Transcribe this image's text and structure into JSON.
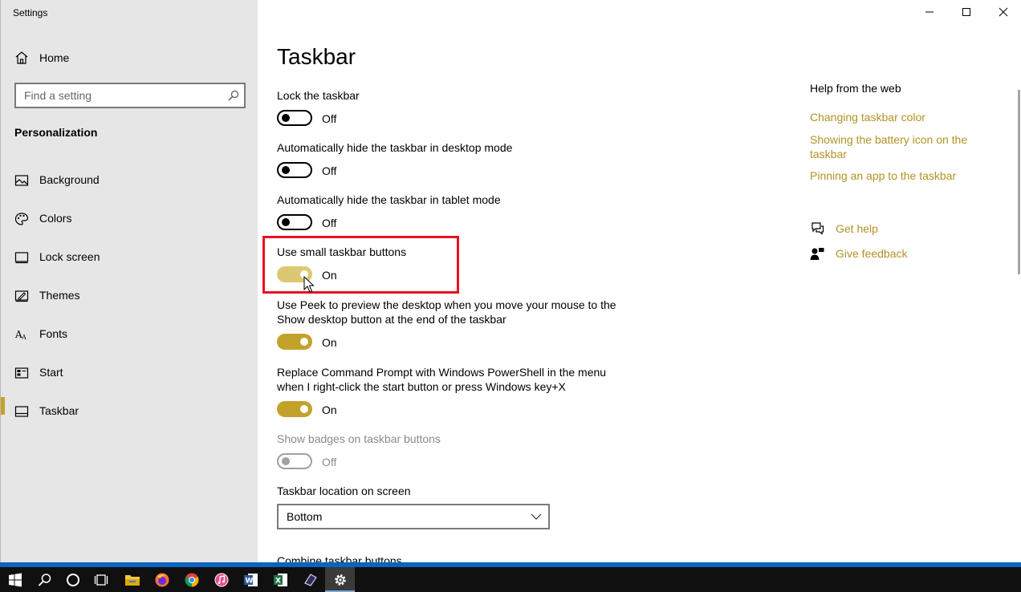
{
  "window": {
    "title": "Settings",
    "controls": {
      "minimize": "minimize",
      "maximize": "maximize",
      "close": "close"
    }
  },
  "sidebar": {
    "home_label": "Home",
    "search_placeholder": "Find a setting",
    "section_title": "Personalization",
    "items": [
      {
        "label": "Background",
        "icon": "picture-icon"
      },
      {
        "label": "Colors",
        "icon": "palette-icon"
      },
      {
        "label": "Lock screen",
        "icon": "lock-screen-icon"
      },
      {
        "label": "Themes",
        "icon": "themes-icon"
      },
      {
        "label": "Fonts",
        "icon": "fonts-icon"
      },
      {
        "label": "Start",
        "icon": "start-icon"
      },
      {
        "label": "Taskbar",
        "icon": "taskbar-icon",
        "selected": true
      }
    ]
  },
  "main": {
    "title": "Taskbar",
    "settings": [
      {
        "label": "Lock the taskbar",
        "state": "Off"
      },
      {
        "label": "Automatically hide the taskbar in desktop mode",
        "state": "Off"
      },
      {
        "label": "Automatically hide the taskbar in tablet mode",
        "state": "Off"
      },
      {
        "label": "Use small taskbar buttons",
        "state": "On"
      },
      {
        "label": "Use Peek to preview the desktop when you move your mouse to the Show desktop button at the end of the taskbar",
        "state": "On"
      },
      {
        "label": "Replace Command Prompt with Windows PowerShell in the menu when I right-click the start button or press Windows key+X",
        "state": "On"
      },
      {
        "label": "Show badges on taskbar buttons",
        "state": "Off",
        "disabled": true
      }
    ],
    "location": {
      "label": "Taskbar location on screen",
      "value": "Bottom"
    },
    "combine_label": "Combine taskbar buttons"
  },
  "help": {
    "title": "Help from the web",
    "links": [
      "Changing taskbar color",
      "Showing the battery icon on the taskbar",
      "Pinning an app to the taskbar"
    ],
    "get_help": "Get help",
    "give_feedback": "Give feedback"
  },
  "colors": {
    "accent": "#c3a22c",
    "link": "#b39224",
    "highlight": "#e81123",
    "taskbar_bg": "#101010",
    "taskbar_top": "#0a64c0"
  },
  "taskbar": {
    "apps": [
      "start-icon",
      "search-icon",
      "cortana-icon",
      "task-view-icon",
      "file-explorer-icon",
      "firefox-icon",
      "chrome-icon",
      "itunes-icon",
      "word-icon",
      "excel-icon",
      "app-icon",
      "settings-icon"
    ]
  }
}
